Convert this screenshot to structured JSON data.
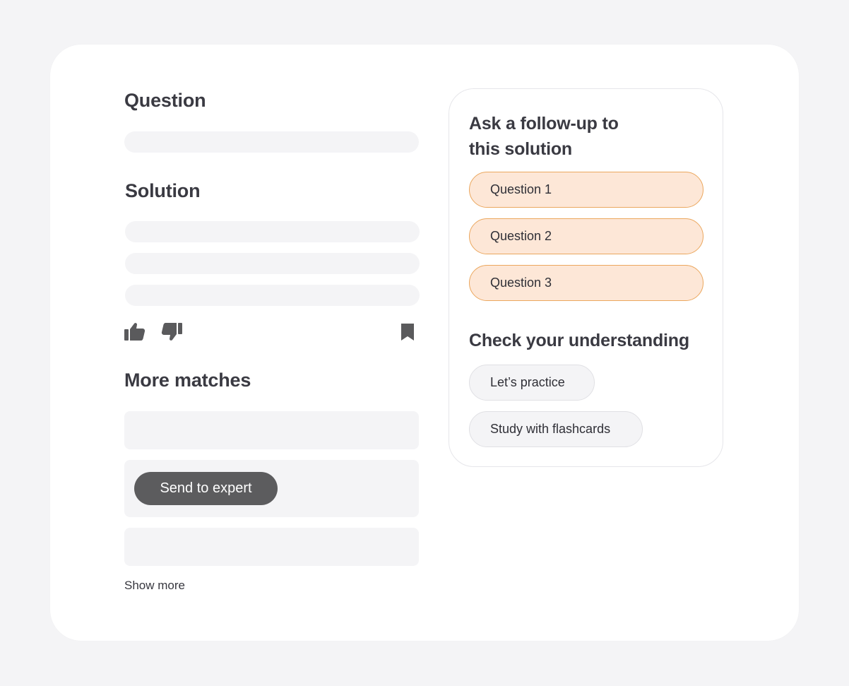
{
  "main": {
    "question_heading": "Question",
    "solution_heading": "Solution",
    "more_matches_heading": "More matches",
    "send_to_expert_label": "Send to expert",
    "show_more_label": "Show more"
  },
  "icons": {
    "thumbs_up": "thumbs-up-icon",
    "thumbs_down": "thumbs-down-icon",
    "bookmark": "bookmark-icon"
  },
  "sidebar": {
    "follow_up_title_line1": "Ask a follow-up to",
    "follow_up_title_line2": "this solution",
    "follow_up_questions": [
      "Question 1",
      "Question 2",
      "Question 3"
    ],
    "understanding_title": "Check your understanding",
    "practice_label": "Let’s practice",
    "flashcards_label": "Study with flashcards"
  },
  "colors": {
    "background": "#f4f4f6",
    "card": "#ffffff",
    "skeleton": "#f4f4f6",
    "pill_orange_fill": "#fde7d7",
    "pill_orange_border": "#eba75e",
    "expert_button": "#5c5c5e",
    "icon": "#5a5a5c"
  }
}
